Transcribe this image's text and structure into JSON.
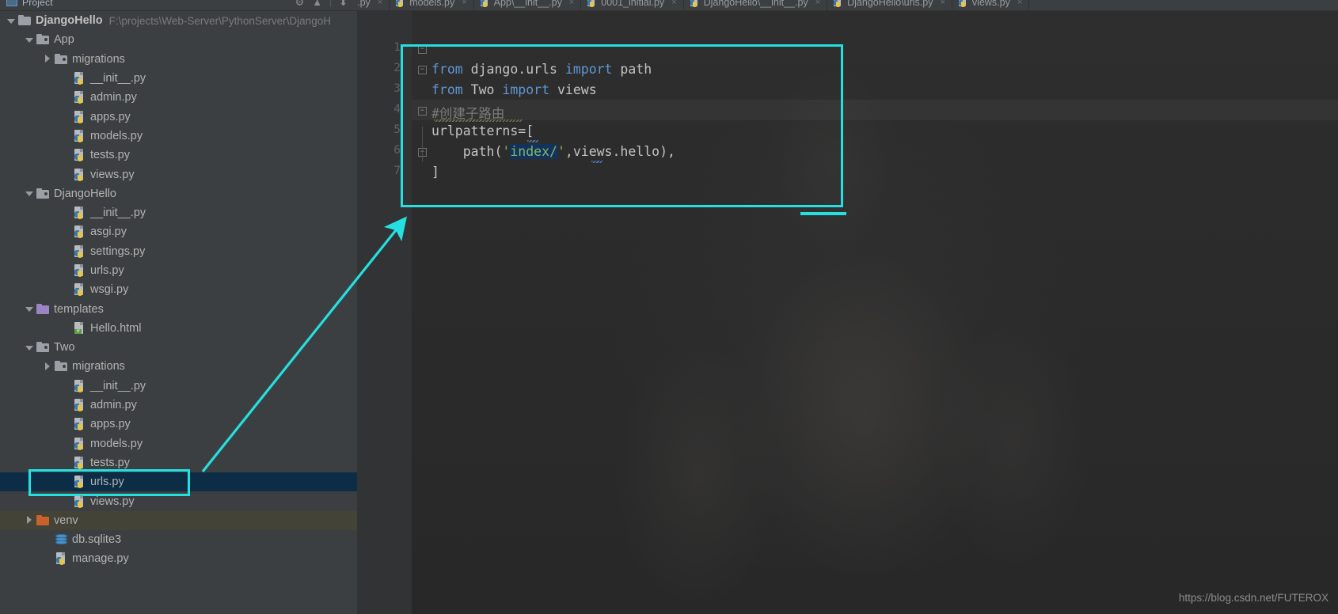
{
  "sidebar": {
    "panel_title": "Project",
    "panel_icon": "project-panel-icon",
    "tools": [
      "settings-gear-icon",
      "collapse-all-icon",
      "hide-icon"
    ],
    "tree": [
      {
        "depth": 0,
        "arrow": "down",
        "icon": "folder-plain",
        "label": "DjangoHello",
        "bold": true,
        "path": "F:\\projects\\Web-Server\\PythonServer\\DjangoH"
      },
      {
        "depth": 1,
        "arrow": "down",
        "icon": "folder",
        "label": "App"
      },
      {
        "depth": 2,
        "arrow": "right",
        "icon": "folder",
        "label": "migrations"
      },
      {
        "depth": 3,
        "arrow": "none",
        "icon": "py",
        "label": "__init__.py"
      },
      {
        "depth": 3,
        "arrow": "none",
        "icon": "py",
        "label": "admin.py"
      },
      {
        "depth": 3,
        "arrow": "none",
        "icon": "py",
        "label": "apps.py"
      },
      {
        "depth": 3,
        "arrow": "none",
        "icon": "py",
        "label": "models.py"
      },
      {
        "depth": 3,
        "arrow": "none",
        "icon": "py",
        "label": "tests.py"
      },
      {
        "depth": 3,
        "arrow": "none",
        "icon": "py",
        "label": "views.py"
      },
      {
        "depth": 1,
        "arrow": "down",
        "icon": "folder",
        "label": "DjangoHello"
      },
      {
        "depth": 3,
        "arrow": "none",
        "icon": "py",
        "label": "__init__.py"
      },
      {
        "depth": 3,
        "arrow": "none",
        "icon": "py",
        "label": "asgi.py"
      },
      {
        "depth": 3,
        "arrow": "none",
        "icon": "py",
        "label": "settings.py"
      },
      {
        "depth": 3,
        "arrow": "none",
        "icon": "py",
        "label": "urls.py"
      },
      {
        "depth": 3,
        "arrow": "none",
        "icon": "py",
        "label": "wsgi.py"
      },
      {
        "depth": 1,
        "arrow": "down",
        "icon": "folder-purple",
        "label": "templates"
      },
      {
        "depth": 3,
        "arrow": "none",
        "icon": "html",
        "label": "Hello.html"
      },
      {
        "depth": 1,
        "arrow": "down",
        "icon": "folder",
        "label": "Two"
      },
      {
        "depth": 2,
        "arrow": "right",
        "icon": "folder",
        "label": "migrations"
      },
      {
        "depth": 3,
        "arrow": "none",
        "icon": "py",
        "label": "__init__.py"
      },
      {
        "depth": 3,
        "arrow": "none",
        "icon": "py",
        "label": "admin.py"
      },
      {
        "depth": 3,
        "arrow": "none",
        "icon": "py",
        "label": "apps.py"
      },
      {
        "depth": 3,
        "arrow": "none",
        "icon": "py",
        "label": "models.py"
      },
      {
        "depth": 3,
        "arrow": "none",
        "icon": "py",
        "label": "tests.py"
      },
      {
        "depth": 3,
        "arrow": "none",
        "icon": "py",
        "label": "urls.py",
        "selected": true
      },
      {
        "depth": 3,
        "arrow": "none",
        "icon": "py",
        "label": "views.py"
      },
      {
        "depth": 1,
        "arrow": "right",
        "icon": "folder-orange",
        "label": "venv",
        "venv": true
      },
      {
        "depth": 2,
        "arrow": "none",
        "icon": "db",
        "label": "db.sqlite3"
      },
      {
        "depth": 2,
        "arrow": "none",
        "icon": "py",
        "label": "manage.py"
      }
    ]
  },
  "editor": {
    "tabs": [
      {
        "label": "apps.py",
        "icon": "python-file-icon",
        "close": "×"
      },
      {
        "label": "models.py",
        "icon": "python-file-icon",
        "close": "×"
      },
      {
        "label": "App\\__init__.py",
        "icon": "python-file-icon",
        "close": "×"
      },
      {
        "label": "0001_initial.py",
        "icon": "python-file-icon",
        "close": "×"
      },
      {
        "label": "DjangoHello\\__init__.py",
        "icon": "python-file-icon",
        "close": "×"
      },
      {
        "label": "DjangoHello\\urls.py",
        "icon": "python-file-icon",
        "close": "×"
      },
      {
        "label": "views.py",
        "icon": "python-file-icon",
        "close": "×"
      }
    ],
    "line_numbers": [
      "1",
      "2",
      "3",
      "4",
      "5",
      "6",
      "7"
    ],
    "code_lines": [
      {
        "n": 1,
        "segments": []
      },
      {
        "n": 2,
        "segments": [
          {
            "t": "from",
            "c": "kw"
          },
          {
            "t": " django.urls ",
            "c": "id"
          },
          {
            "t": "import",
            "c": "kw"
          },
          {
            "t": " path",
            "c": "id"
          }
        ]
      },
      {
        "n": 3,
        "segments": [
          {
            "t": "from",
            "c": "kw"
          },
          {
            "t": " Two ",
            "c": "id"
          },
          {
            "t": "import",
            "c": "kw"
          },
          {
            "t": " views",
            "c": "id"
          }
        ]
      },
      {
        "n": 4,
        "segments": [
          {
            "t": "#创建子路由",
            "c": "cmt"
          }
        ]
      },
      {
        "n": 5,
        "segments": [
          {
            "t": "urlpatterns=[",
            "c": "id"
          }
        ]
      },
      {
        "n": 6,
        "segments": [
          {
            "t": "    path(",
            "c": "id"
          },
          {
            "t": "'",
            "c": "str"
          },
          {
            "t": "index/",
            "c": "str sel-hl"
          },
          {
            "t": "'",
            "c": "str"
          },
          {
            "t": ",views.hello),",
            "c": "id"
          }
        ]
      },
      {
        "n": 7,
        "segments": [
          {
            "t": "]",
            "c": "id"
          }
        ]
      }
    ],
    "raw_code": "from django.urls import path\nfrom Two import views\n#创建子路由\nurlpatterns=[\n    path('index/',views.hello),\n]"
  },
  "annotations": {
    "color": "#25e0e0",
    "code_box": "highlight-rectangle-around-code",
    "file_box": "highlight-rectangle-around-urls-py",
    "arrow": "arrow-from-urls-py-to-code"
  },
  "watermark": {
    "text": "https://blog.csdn.net/FUTEROX"
  }
}
